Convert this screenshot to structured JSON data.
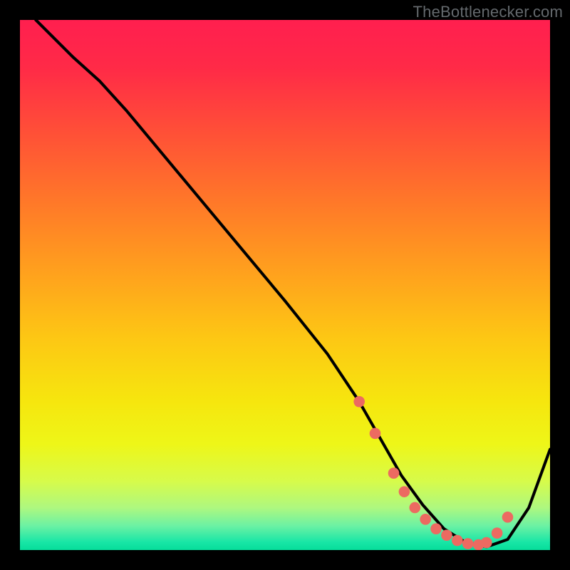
{
  "attribution": "TheBottlenecker.com",
  "chart_data": {
    "type": "line",
    "title": "",
    "xlabel": "",
    "ylabel": "",
    "xlim": [
      0,
      100
    ],
    "ylim": [
      0,
      100
    ],
    "series": [
      {
        "name": "curve",
        "x": [
          3,
          10,
          15,
          20,
          30,
          40,
          50,
          58,
          64,
          68,
          72,
          76,
          80,
          84,
          88,
          92,
          96,
          100
        ],
        "y": [
          100,
          93,
          88.5,
          83,
          71,
          59,
          47,
          37,
          28,
          21,
          14,
          8.5,
          4,
          1.5,
          0.6,
          2,
          8,
          19
        ]
      }
    ],
    "markers": {
      "name": "dots",
      "x": [
        64,
        67,
        70.5,
        72.5,
        74.5,
        76.5,
        78.5,
        80.5,
        82.5,
        84.5,
        86.5,
        88,
        90,
        92
      ],
      "y": [
        28,
        22,
        14.5,
        11,
        8,
        5.8,
        4,
        2.8,
        1.8,
        1.2,
        1,
        1.4,
        3.2,
        6.2
      ]
    },
    "gradient_stops": [
      {
        "offset": 0.0,
        "color": "#ff1f4f"
      },
      {
        "offset": 0.09,
        "color": "#ff2a47"
      },
      {
        "offset": 0.22,
        "color": "#ff5236"
      },
      {
        "offset": 0.35,
        "color": "#ff7a28"
      },
      {
        "offset": 0.48,
        "color": "#ffa21d"
      },
      {
        "offset": 0.6,
        "color": "#fdc714"
      },
      {
        "offset": 0.72,
        "color": "#f6e60e"
      },
      {
        "offset": 0.8,
        "color": "#eef618"
      },
      {
        "offset": 0.87,
        "color": "#d7fb4a"
      },
      {
        "offset": 0.92,
        "color": "#aef87f"
      },
      {
        "offset": 0.955,
        "color": "#6af1a4"
      },
      {
        "offset": 0.985,
        "color": "#18e6a6"
      },
      {
        "offset": 1.0,
        "color": "#06dd9a"
      }
    ],
    "marker_color": "#ec6a61",
    "line_color": "#000000"
  }
}
